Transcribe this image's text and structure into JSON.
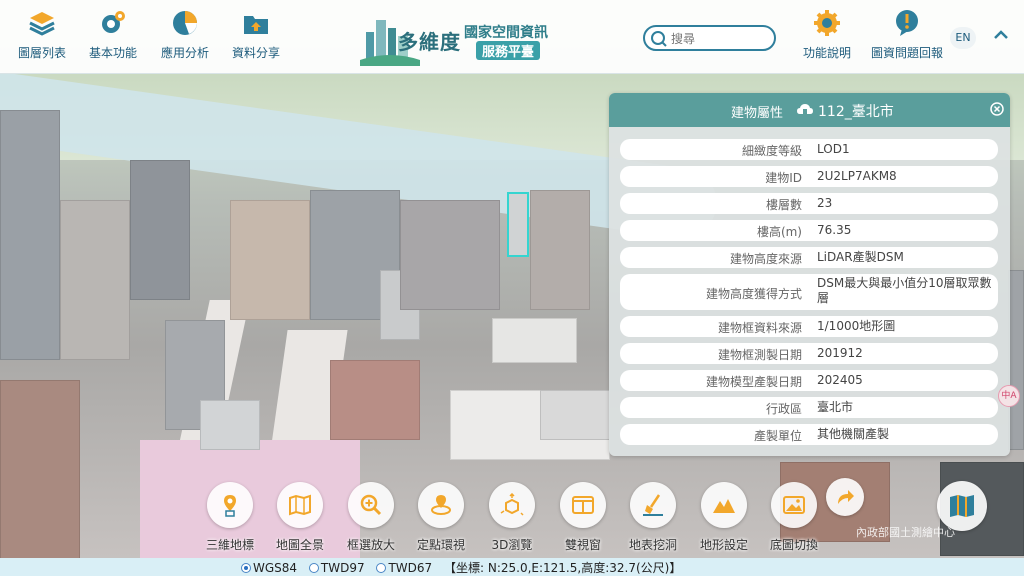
{
  "nav": {
    "items": [
      {
        "label": "圖層列表",
        "icon": "layers-icon"
      },
      {
        "label": "基本功能",
        "icon": "gear-icon"
      },
      {
        "label": "應用分析",
        "icon": "pie-chart-icon"
      },
      {
        "label": "資料分享",
        "icon": "share-folder-icon"
      }
    ],
    "logo": {
      "title_main": "多維度",
      "title_sub": "國家空間資訊",
      "title_badge": "服務平臺"
    },
    "search_placeholder": "搜尋",
    "help_label": "功能說明",
    "report_label": "圖資問題回報",
    "lang_label": "EN"
  },
  "panel": {
    "title": "建物屬性",
    "subtitle": "112_臺北市",
    "rows": [
      {
        "key": "細緻度等級",
        "value": "LOD1"
      },
      {
        "key": "建物ID",
        "value": "2U2LP7AKM8"
      },
      {
        "key": "樓層數",
        "value": "23"
      },
      {
        "key": "樓高(m)",
        "value": "76.35"
      },
      {
        "key": "建物高度來源",
        "value": "LiDAR產製DSM"
      },
      {
        "key": "建物高度獲得方式",
        "value": "DSM最大與最小值分10層取眾數層"
      },
      {
        "key": "建物框資料來源",
        "value": "1/1000地形圖"
      },
      {
        "key": "建物框測製日期",
        "value": "201912"
      },
      {
        "key": "建物模型產製日期",
        "value": "202405"
      },
      {
        "key": "行政區",
        "value": "臺北市"
      },
      {
        "key": "產製單位",
        "value": "其他機關產製"
      }
    ]
  },
  "toolbar": {
    "items": [
      {
        "label": "三維地標",
        "icon": "landmark-pin-icon"
      },
      {
        "label": "地圖全景",
        "icon": "panorama-map-icon"
      },
      {
        "label": "框選放大",
        "icon": "zoom-in-icon"
      },
      {
        "label": "定點環視",
        "icon": "orbit-pin-icon"
      },
      {
        "label": "3D瀏覽",
        "icon": "cube-navigate-icon"
      },
      {
        "label": "雙視窗",
        "icon": "dual-window-icon"
      },
      {
        "label": "地表挖洞",
        "icon": "dig-shovel-icon"
      },
      {
        "label": "地形設定",
        "icon": "terrain-icon"
      },
      {
        "label": "底圖切換",
        "icon": "basemap-switch-icon"
      }
    ]
  },
  "side": {
    "badge": "中A"
  },
  "watermark": "內政部國土測繪中心",
  "status": {
    "options": [
      "WGS84",
      "TWD97",
      "TWD67"
    ],
    "selected": "WGS84",
    "coords": "【坐標: N:25.0,E:121.5,高度:32.7(公尺)】"
  },
  "colors": {
    "accent": "#5a9e9c",
    "nav_text": "#1d5b7c",
    "icon_orange": "#f2a72b",
    "icon_blue": "#2f7f9c"
  }
}
